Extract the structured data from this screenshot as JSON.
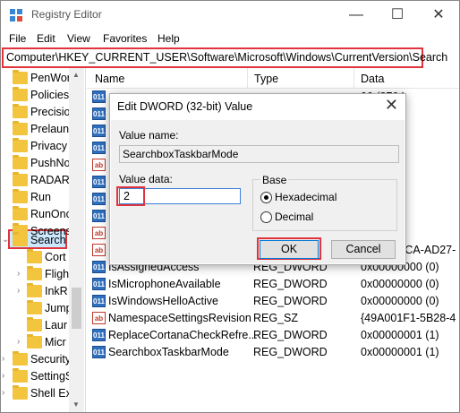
{
  "window": {
    "title": "Registry Editor",
    "minimize": "—",
    "maximize": "☐",
    "close": "✕"
  },
  "menu": [
    "File",
    "Edit",
    "View",
    "Favorites",
    "Help"
  ],
  "address": "Computer\\HKEY_CURRENT_USER\\Software\\Microsoft\\Windows\\CurrentVersion\\Search",
  "tree": [
    "PenWor",
    "Policies",
    "Precisio",
    "Prelaun",
    "Privacy",
    "PushNo",
    "RADAR",
    "Run",
    "RunOnc",
    "Screens",
    "Search",
    "Cort",
    "Fligh",
    "InkR",
    "Jump",
    "Laur",
    "Micr",
    "Security",
    "SettingS",
    "Shell Ex"
  ],
  "list": {
    "headers": {
      "name": "Name",
      "type": "Type",
      "data": "Data"
    },
    "rows": [
      {
        "icon": "dw",
        "name": "",
        "type": "",
        "data": "00 (8704"
      },
      {
        "icon": "dw",
        "name": "",
        "type": "",
        "data": "(1)"
      },
      {
        "icon": "dw",
        "name": "",
        "type": "",
        "data": "(0)"
      },
      {
        "icon": "dw",
        "name": "",
        "type": "",
        "data": "(0)"
      },
      {
        "icon": "sz",
        "name": "",
        "type": "",
        "data": "b163bb4"
      },
      {
        "icon": "dw",
        "name": "",
        "type": "",
        "data": "led 00 00"
      },
      {
        "icon": "dw",
        "name": "",
        "type": "",
        "data": "01 (1)"
      },
      {
        "icon": "dw",
        "name": "",
        "type": "",
        "data": "(0)"
      },
      {
        "icon": "sz",
        "name": "",
        "type": "",
        "data": "5-3F7A-"
      },
      {
        "icon": "sz",
        "name": "InstalledWin32AppsRevision",
        "type": "REG_SZ",
        "data": "{69F5FDCA-AD27-"
      },
      {
        "icon": "dw",
        "name": "IsAssignedAccess",
        "type": "REG_DWORD",
        "data": "0x00000000 (0)"
      },
      {
        "icon": "dw",
        "name": "IsMicrophoneAvailable",
        "type": "REG_DWORD",
        "data": "0x00000000 (0)"
      },
      {
        "icon": "dw",
        "name": "IsWindowsHelloActive",
        "type": "REG_DWORD",
        "data": "0x00000000 (0)"
      },
      {
        "icon": "sz",
        "name": "NamespaceSettingsRevision",
        "type": "REG_SZ",
        "data": "{49A001F1-5B28-4"
      },
      {
        "icon": "dw",
        "name": "ReplaceCortanaCheckRefre...",
        "type": "REG_DWORD",
        "data": "0x00000001 (1)"
      },
      {
        "icon": "dw",
        "name": "SearchboxTaskbarMode",
        "type": "REG_DWORD",
        "data": "0x00000001 (1)"
      }
    ]
  },
  "dialog": {
    "title": "Edit DWORD (32-bit) Value",
    "close": "✕",
    "value_name_label": "Value name:",
    "value_name": "SearchboxTaskbarMode",
    "value_data_label": "Value data:",
    "value_data": "2",
    "base_label": "Base",
    "hex_label": "Hexadecimal",
    "dec_label": "Decimal",
    "selected_base": "Hexadecimal",
    "ok": "OK",
    "cancel": "Cancel"
  },
  "colors": {
    "highlight": "#e0343d",
    "selection": "#cce8ff",
    "folder": "#f3c53f"
  }
}
